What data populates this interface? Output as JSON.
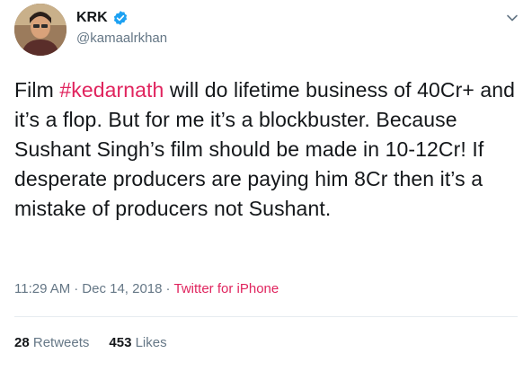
{
  "user": {
    "display_name": "KRK",
    "handle": "@kamaalrkhan",
    "verified": true
  },
  "tweet": {
    "text_parts": [
      "Film ",
      "#kedarnath",
      " will do lifetime business of 40Cr+ and it’s a flop. But for me it’s a blockbuster. Because Sushant Singh’s film should be made in 10-12Cr! If desperate producers are paying him 8Cr then it’s a mistake of producers not Sushant."
    ],
    "time": "11:29 AM",
    "separator": "·",
    "date": "Dec 14, 2018",
    "source": "Twitter for iPhone"
  },
  "stats": {
    "retweets_count": "28",
    "retweets_label": "Retweets",
    "likes_count": "453",
    "likes_label": "Likes"
  },
  "icons": {
    "verified": "verified-badge-icon",
    "menu": "chevron-down-icon"
  },
  "colors": {
    "accent": "#e0245e",
    "verified": "#1da1f2",
    "secondary_text": "#657786",
    "primary_text": "#14171a"
  }
}
